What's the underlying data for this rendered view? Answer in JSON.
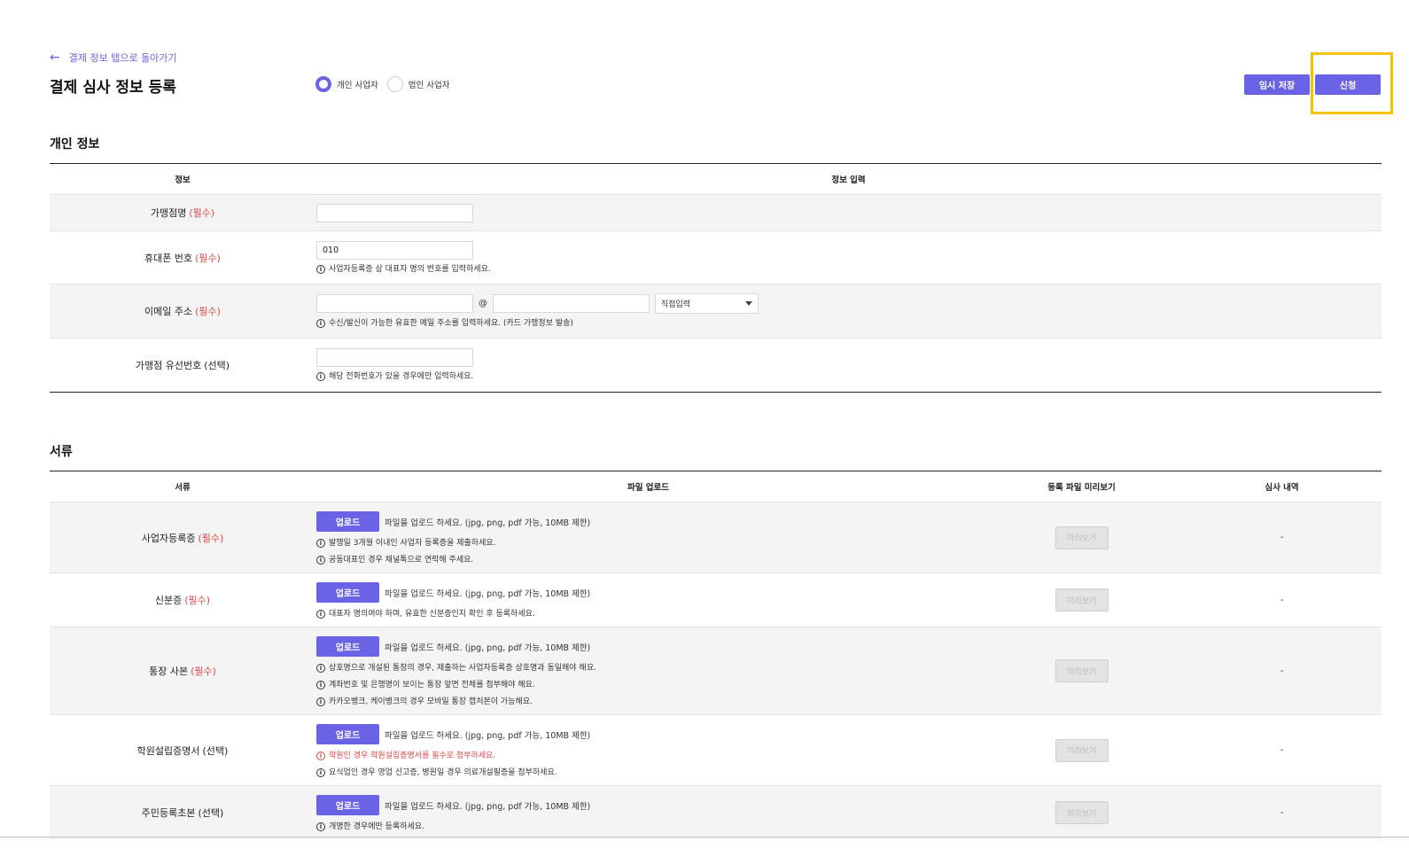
{
  "header": {
    "back_link": "결제 정보 탭으로 돌아가기",
    "title": "결제 심사 정보 등록",
    "business_types": [
      "개인 사업자",
      "법인 사업자"
    ],
    "selected_type": "개인 사업자",
    "temp_save_label": "임시 저장",
    "apply_label": "신청"
  },
  "personal": {
    "section_title": "개인 정보",
    "columns": [
      "정보",
      "정보 입력"
    ],
    "required_tag": "(필수)",
    "optional_tag": "(선택)",
    "fields": {
      "store_name": {
        "label": "가맹점명",
        "value": ""
      },
      "phone": {
        "label": "휴대폰 번호",
        "value": "010",
        "hint": "사업자등록증 상 대표자 명의 번호를 입력하세요."
      },
      "email": {
        "label": "이메일 주소",
        "local": "",
        "domain": "",
        "at": "@",
        "select": "직접입력",
        "hint": "수신/발신이 가능한 유효한 메일 주소를 입력하세요. (카드 가맹정보 발송)"
      },
      "landline": {
        "label": "가맹점 유선번호",
        "value": "",
        "hint": "해당 전화번호가 있을 경우에만 입력하세요."
      }
    }
  },
  "documents": {
    "section_title": "서류",
    "columns": [
      "서류",
      "파일 업로드",
      "등록 파일 미리보기",
      "심사 내역"
    ],
    "upload_label": "업로드",
    "upload_hint": "파일을 업로드 하세요. (jpg, png, pdf 가능, 10MB 제한)",
    "preview_label": "미리보기",
    "review_placeholder": "-",
    "items": [
      {
        "label": "사업자등록증",
        "hints": [
          "발행일 3개월 이내인 사업자 등록증을 제출하세요.",
          "공동대표인 경우 채널톡으로 연락해 주세요."
        ]
      },
      {
        "label": "신분증",
        "hints": [
          "대표자 명의여야 하며, 유효한 신분증인지 확인 후 등록하세요."
        ]
      },
      {
        "label": "통장 사본",
        "hints": [
          "상호명으로 개설된 통장의 경우, 제출하는 사업자등록증 상호명과 동일해야 해요.",
          "계좌번호 및 은행명이 보이는 통장 앞면 전체를 첨부해야 해요.",
          "카카오뱅크, 케이뱅크의 경우 모바일 통장 캡처본이 가능해요."
        ]
      },
      {
        "label": "학원설립증명서",
        "warning": "학원인 경우 학원설립증명서를 필수로 첨부하세요.",
        "hints": [
          "요식업인 경우 영업 신고증, 병원일 경우 의료개설필증을 첨부하세요."
        ]
      },
      {
        "label": "주민등록초본",
        "hints": [
          "개명한 경우에만 등록하세요."
        ]
      }
    ]
  },
  "colors": {
    "accent": "#6b63e6",
    "required": "#e04848",
    "highlight": "#f5c200"
  }
}
